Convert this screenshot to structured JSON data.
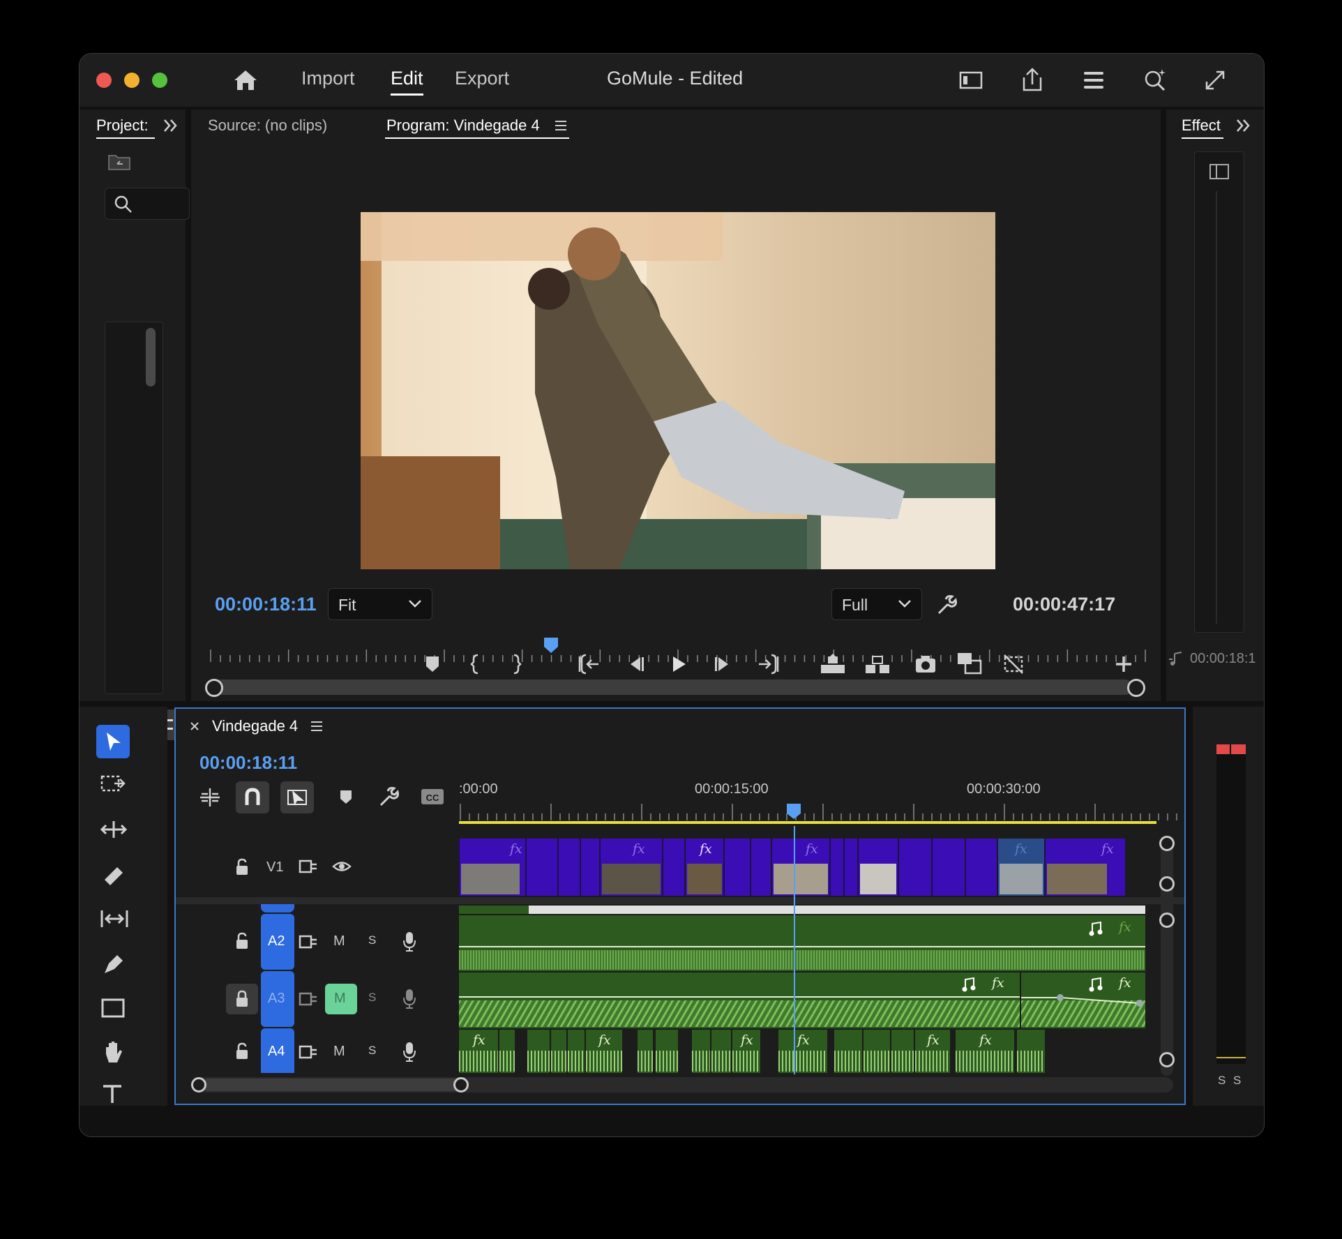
{
  "titlebar": {
    "nav": [
      "Import",
      "Edit",
      "Export"
    ],
    "active_nav": "Edit",
    "project_name": "GoMule",
    "project_status": "- Edited"
  },
  "left_panel": {
    "tab_label": "Project:"
  },
  "monitor": {
    "source_tab": "Source: (no clips)",
    "program_tab": "Program: Vindegade 4",
    "current_timecode": "00:00:18:11",
    "fit_label": "Fit",
    "quality_label": "Full",
    "duration_timecode": "00:00:47:17",
    "playhead_progress": 0.364
  },
  "right_panel": {
    "tab_label": "Effect",
    "timecode_partial": "00:00:18:1"
  },
  "timeline": {
    "sequence_name": "Vindegade 4",
    "timecode": "00:00:18:11",
    "ruler_labels": [
      ":00:00",
      "00:00:15:00",
      "00:00:30:00"
    ],
    "tracks": {
      "v1": "V1",
      "a2": "A2",
      "a3": "A3",
      "a4": "A4",
      "mute": "M",
      "solo": "S"
    }
  },
  "meter": {
    "labels": [
      "S",
      "S"
    ]
  },
  "colors": {
    "accent_blue": "#5aa0f2",
    "video_clip": "#3b0db5",
    "audio_clip": "#2d5a1e",
    "mute_active": "#6bd39a",
    "track_target": "#2f6be0"
  }
}
